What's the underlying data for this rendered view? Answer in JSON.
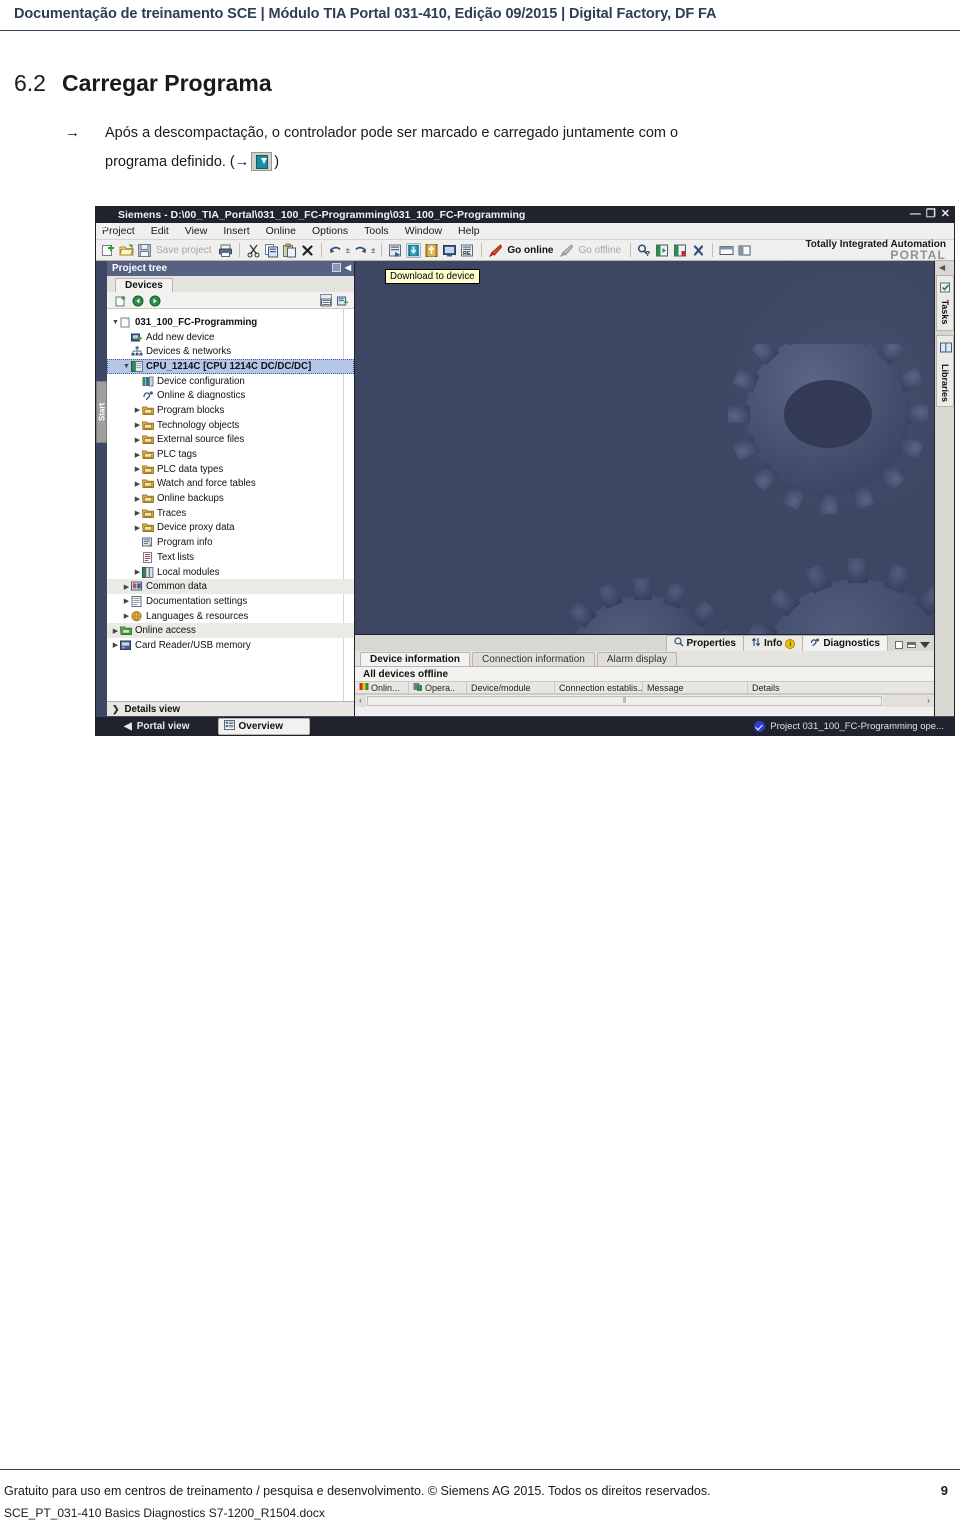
{
  "doc": {
    "header": "Documentação de treinamento SCE | Módulo TIA Portal 031-410, Edição 09/2015 | Digital Factory, DF FA",
    "section_number": "6.2",
    "section_title": "Carregar Programa",
    "arrow": "→",
    "paragraph_line1": "Após a descompactação, o controlador pode ser marcado e carregado juntamente com o",
    "paragraph_line2_pre": "programa definido. (",
    "paragraph_line2_arrow": "→",
    "paragraph_line2_post": ")",
    "footer_line1": "Gratuito para uso em centros de treinamento / pesquisa e desenvolvimento. © Siemens AG 2015. Todos os direitos reservados.",
    "footer_line2": "SCE_PT_031-410 Basics Diagnostics S7-1200_R1504.docx",
    "page_number": "9"
  },
  "tia": {
    "title": "Siemens  -  D:\\00_TIA_Portal\\031_100_FC-Programming\\031_100_FC-Programming",
    "window_buttons": {
      "minimize": "—",
      "maximize": "❐",
      "close": "✕"
    },
    "menu": [
      "Project",
      "Edit",
      "View",
      "Insert",
      "Online",
      "Options",
      "Tools",
      "Window",
      "Help"
    ],
    "toolbar": {
      "save_project": "Save project",
      "go_online": "Go online",
      "go_offline": "Go offline"
    },
    "brand": {
      "line1": "Totally Integrated Automation",
      "line2": "PORTAL"
    },
    "left_rail_tab": "Start",
    "project_tree": {
      "title": "Project tree",
      "tab": "Devices",
      "items": [
        {
          "label": "031_100_FC-Programming",
          "indent": 0,
          "expander": "▼",
          "icon": "project-icon",
          "bold": true,
          "selected": false,
          "grey": false
        },
        {
          "label": "Add new device",
          "indent": 1,
          "expander": "",
          "icon": "add-device-icon",
          "bold": false,
          "selected": false,
          "grey": false
        },
        {
          "label": "Devices & networks",
          "indent": 1,
          "expander": "",
          "icon": "devices-networks-icon",
          "bold": false,
          "selected": false,
          "grey": false
        },
        {
          "label": "CPU_1214C [CPU 1214C DC/DC/DC]",
          "indent": 1,
          "expander": "▼",
          "icon": "plc-icon",
          "bold": true,
          "selected": true,
          "grey": false
        },
        {
          "label": "Device configuration",
          "indent": 2,
          "expander": "",
          "icon": "device-config-icon",
          "bold": false,
          "selected": false,
          "grey": false
        },
        {
          "label": "Online & diagnostics",
          "indent": 2,
          "expander": "",
          "icon": "online-diagnostics-icon",
          "bold": false,
          "selected": false,
          "grey": false
        },
        {
          "label": "Program blocks",
          "indent": 2,
          "expander": "▶",
          "icon": "folder-icon",
          "bold": false,
          "selected": false,
          "grey": false
        },
        {
          "label": "Technology objects",
          "indent": 2,
          "expander": "▶",
          "icon": "folder-icon",
          "bold": false,
          "selected": false,
          "grey": false
        },
        {
          "label": "External source files",
          "indent": 2,
          "expander": "▶",
          "icon": "folder-icon",
          "bold": false,
          "selected": false,
          "grey": false
        },
        {
          "label": "PLC tags",
          "indent": 2,
          "expander": "▶",
          "icon": "folder-icon",
          "bold": false,
          "selected": false,
          "grey": false
        },
        {
          "label": "PLC data types",
          "indent": 2,
          "expander": "▶",
          "icon": "folder-icon",
          "bold": false,
          "selected": false,
          "grey": false
        },
        {
          "label": "Watch and force tables",
          "indent": 2,
          "expander": "▶",
          "icon": "folder-icon",
          "bold": false,
          "selected": false,
          "grey": false
        },
        {
          "label": "Online backups",
          "indent": 2,
          "expander": "▶",
          "icon": "folder-icon",
          "bold": false,
          "selected": false,
          "grey": false
        },
        {
          "label": "Traces",
          "indent": 2,
          "expander": "▶",
          "icon": "folder-icon",
          "bold": false,
          "selected": false,
          "grey": false
        },
        {
          "label": "Device proxy data",
          "indent": 2,
          "expander": "▶",
          "icon": "folder-icon",
          "bold": false,
          "selected": false,
          "grey": false
        },
        {
          "label": "Program info",
          "indent": 2,
          "expander": "",
          "icon": "program-info-icon",
          "bold": false,
          "selected": false,
          "grey": false
        },
        {
          "label": "Text lists",
          "indent": 2,
          "expander": "",
          "icon": "text-lists-icon",
          "bold": false,
          "selected": false,
          "grey": false
        },
        {
          "label": "Local modules",
          "indent": 2,
          "expander": "▶",
          "icon": "local-modules-icon",
          "bold": false,
          "selected": false,
          "grey": false
        },
        {
          "label": "Common data",
          "indent": 1,
          "expander": "▶",
          "icon": "common-data-icon",
          "bold": false,
          "selected": false,
          "grey": true
        },
        {
          "label": "Documentation settings",
          "indent": 1,
          "expander": "▶",
          "icon": "doc-settings-icon",
          "bold": false,
          "selected": false,
          "grey": false
        },
        {
          "label": "Languages & resources",
          "indent": 1,
          "expander": "▶",
          "icon": "languages-icon",
          "bold": false,
          "selected": false,
          "grey": false
        },
        {
          "label": "Online access",
          "indent": 0,
          "expander": "▶",
          "icon": "online-access-icon",
          "bold": false,
          "selected": false,
          "grey": true
        },
        {
          "label": "Card Reader/USB memory",
          "indent": 0,
          "expander": "▶",
          "icon": "card-reader-icon",
          "bold": false,
          "selected": false,
          "grey": false
        }
      ],
      "details_view": "Details view",
      "details_chevron": "❯"
    },
    "work_area": {
      "tooltip": "Download to device"
    },
    "inspector": {
      "tabs": [
        {
          "label": "Properties",
          "icon": "properties-icon",
          "active": false
        },
        {
          "label": "Info",
          "icon": "info-icon",
          "active": false,
          "badge": "i"
        },
        {
          "label": "Diagnostics",
          "icon": "diagnostics-icon",
          "active": true
        }
      ],
      "subtabs": [
        {
          "label": "Device information",
          "active": true
        },
        {
          "label": "Connection information",
          "active": false
        },
        {
          "label": "Alarm display",
          "active": false
        }
      ],
      "status": "All devices offline",
      "columns": [
        "Onlin...",
        "Opera..",
        "Device/module",
        "Connection establis..",
        "Message",
        "Details"
      ],
      "scroll_marker": "‖",
      "scroll_left": "‹",
      "scroll_right": "›"
    },
    "right_rail": {
      "collapse_arrow": "◀",
      "tabs": [
        {
          "label": "Tasks",
          "icon": "tasks-icon"
        },
        {
          "label": "Libraries",
          "icon": "libraries-icon"
        }
      ]
    },
    "status_bar": {
      "portal_view": "Portal view",
      "portal_arrow": "◀",
      "overview": "Overview",
      "project_message": "Project 031_100_FC-Programming ope..."
    }
  },
  "colors": {
    "header_blue": "#2e3d54",
    "work_bg": "#3d4663",
    "title_bar": "#20232e",
    "tree_title": "#566184",
    "selection": "#b6c6e8",
    "tooltip_bg": "#ffffcc",
    "accent_blue": "#2c3fd0"
  }
}
